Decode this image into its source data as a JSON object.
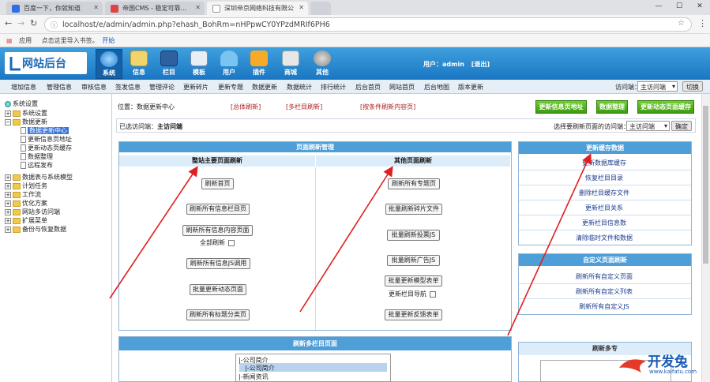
{
  "browser": {
    "tabs": [
      {
        "title": "百度一下，你就知道"
      },
      {
        "title": "帝国CMS - 稳定可靠..."
      },
      {
        "title": "深圳帝京网络科技有限公"
      }
    ],
    "url": "localhost/e/admin/admin.php?ehash_BohRm=nHPpwCY0YPzdMRIf6PH6",
    "bookmarks": {
      "apps": "应用",
      "hint": "点击这里导入书签。",
      "start": "开始"
    }
  },
  "header": {
    "logo": "网站后台",
    "nav": [
      "系统",
      "信息",
      "栏目",
      "模板",
      "用户",
      "插件",
      "商城",
      "其他"
    ],
    "user_label": "用户：admin",
    "logout": "[退出]"
  },
  "subnav": {
    "items": [
      "增加信息",
      "管理信息",
      "审核信息",
      "签发信息",
      "管理评论",
      "更新碎片",
      "更新专题",
      "数据更新",
      "数据统计",
      "排行统计",
      "后台首页",
      "网站首页",
      "后台地图",
      "版本更新"
    ],
    "visit_label": "访问端：",
    "visit_value": "主访问端",
    "switch": "切换"
  },
  "sidebar": {
    "root": "系统设置",
    "items": [
      {
        "label": "系统设置",
        "kind": "plus"
      },
      {
        "label": "数据更新",
        "kind": "minus"
      },
      {
        "label": "数据更新中心",
        "kind": "doc",
        "selected": true
      },
      {
        "label": "更新信息页地址",
        "kind": "doc"
      },
      {
        "label": "更新动态页缓存",
        "kind": "doc"
      },
      {
        "label": "数据整理",
        "kind": "doc"
      },
      {
        "label": "远程发布",
        "kind": "doc"
      },
      {
        "label": "数据表与系统模型",
        "kind": "plus"
      },
      {
        "label": "计划任务",
        "kind": "plus"
      },
      {
        "label": "工作流",
        "kind": "plus"
      },
      {
        "label": "优化方案",
        "kind": "plus"
      },
      {
        "label": "网站多访问端",
        "kind": "plus"
      },
      {
        "label": "扩展菜单",
        "kind": "plus"
      },
      {
        "label": "备份与恢复数据",
        "kind": "plus"
      }
    ]
  },
  "main": {
    "position": "位置：数据更新中心",
    "links": [
      "[总体刷新]",
      "[多栏目刷新]",
      "[按条件刷新内容页]"
    ],
    "green_buttons": [
      "更新信息页地址",
      "数据整理",
      "更新动态页面缓存"
    ],
    "visited_label": "已选访问端：",
    "visited_value": "主访问端",
    "choose_label": "选择要刷新页面的访问端：",
    "choose_value": "主访问端",
    "confirm": "确定",
    "refresh_panel": {
      "title": "页面刷新管理",
      "left_head": "整站主要页面刷新",
      "right_head": "其他页面刷新",
      "left_buttons": [
        "刷新首页",
        "刷新所有信息栏目页",
        "刷新所有信息内容页面",
        "刷新所有信息JS调用",
        "批量更新动态页面",
        "刷新所有标题分类页"
      ],
      "all_refresh": "全部刷新",
      "right_buttons": [
        "刷新所有专题页",
        "批量刷新碎片文件",
        "批量刷新投票JS",
        "批量刷新广告JS",
        "批量更新模型表单",
        "批量更新反馈表单"
      ],
      "update_nav": "更新栏目导航"
    },
    "cache_panel": {
      "title": "更新缓存数据",
      "links": [
        "更新数据库缓存",
        "恢复栏目目录",
        "删除栏目缓存文件",
        "更新栏目关系",
        "更新栏目信息数",
        "清除临时文件和数据"
      ]
    },
    "custom_panel": {
      "title": "自定义页面刷新",
      "links": [
        "刷新所有自定义页面",
        "刷新所有自定义列表",
        "刷新所有自定义JS"
      ]
    },
    "multi_panel": {
      "title": "刷新多栏目页面",
      "options": [
        "|-公司简介",
        "|-公司简介",
        "|-新闻资讯"
      ]
    },
    "other_panel": {
      "title": "刷新多专"
    }
  },
  "watermark": {
    "text": "开发兔",
    "url": "www.kaifatu.com"
  },
  "colors": {
    "header": "#1a76c2",
    "panel_head": "#4e9ed8",
    "green": "#4fae1c",
    "arrow": "#e02020"
  }
}
